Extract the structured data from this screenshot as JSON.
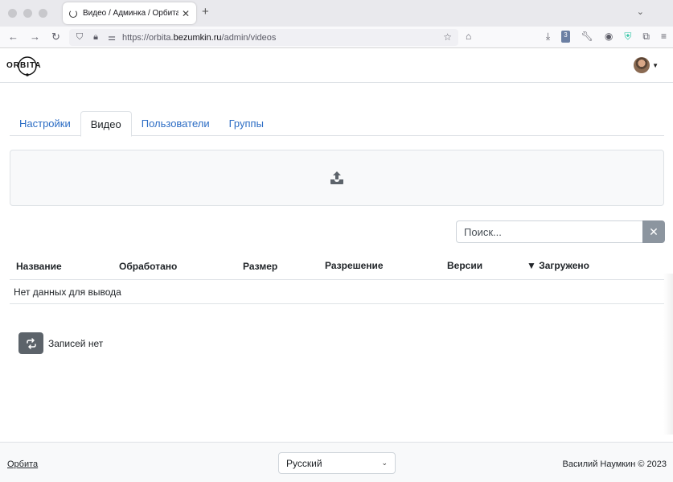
{
  "browser": {
    "tab_title": "Видео / Админка / Орбита",
    "url_prefix": "https://orbita.",
    "url_domain": "bezumkin.ru",
    "url_path": "/admin/videos",
    "extension_badge": "3"
  },
  "app": {
    "logo_text": "ORBITA"
  },
  "tabs": [
    {
      "label": "Настройки",
      "active": false
    },
    {
      "label": "Видео",
      "active": true
    },
    {
      "label": "Пользователи",
      "active": false
    },
    {
      "label": "Группы",
      "active": false
    }
  ],
  "search": {
    "placeholder": "Поиск..."
  },
  "table": {
    "headers": [
      "Название",
      "Обработано",
      "Размер",
      "Разрешение",
      "Версии",
      "▼ Загружено"
    ],
    "empty_text": "Нет данных для вывода"
  },
  "pagination": {
    "records_text": "Записей нет"
  },
  "footer": {
    "link": "Орбита",
    "language": "Русский",
    "copyright": "Василий Наумкин © 2023"
  },
  "colors": {
    "link": "#2b6cc4",
    "refresh_button": "#5c636a",
    "clear_button": "#8c959f"
  }
}
